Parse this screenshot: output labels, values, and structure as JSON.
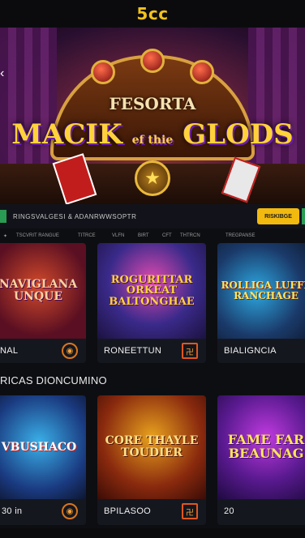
{
  "header": {
    "brand": "5cc"
  },
  "hero": {
    "subtitle": "FESORTA",
    "title": "MACIK",
    "title_mid": "ef thie",
    "title_end": "GLODS"
  },
  "jackpot": {
    "text": "RINGSVALGESI & ADANRWWSOPTR",
    "button_label": "RISKIBGE"
  },
  "tag_row": [
    "TSCVRIT RANGUE",
    "TITRCE",
    "VLFN",
    "BIRT",
    "CFT",
    "THTRCN",
    "TREGPANSE"
  ],
  "row1": [
    {
      "art": "NAVIGLANA UNQUE",
      "name": "NAL",
      "icon": "coin-icon"
    },
    {
      "art": "ROGURITTAR\nORKEAT BALTONGHAE",
      "name": "RONEETTUN",
      "icon": "castle-icon"
    },
    {
      "art": "ROLLIGA LUFFE RANCHAGE",
      "name": "BIALIGNCIA",
      "icon": "coin-icon"
    }
  ],
  "section_title": "RICAS DIONCUMINO",
  "row2": [
    {
      "art": "VBUSHACO",
      "name": "30 in",
      "icon": "coin-icon"
    },
    {
      "art": "CORE THAYLE TOUDIER",
      "name": "BPILASOO",
      "icon": "castle-icon"
    },
    {
      "art": "FAME FAR BEAUNAG",
      "name": "20",
      "icon": "coin-icon"
    }
  ],
  "colors": {
    "accent": "#f3c21b",
    "background": "#0d0e12",
    "fav_ring": "#d9761d"
  }
}
